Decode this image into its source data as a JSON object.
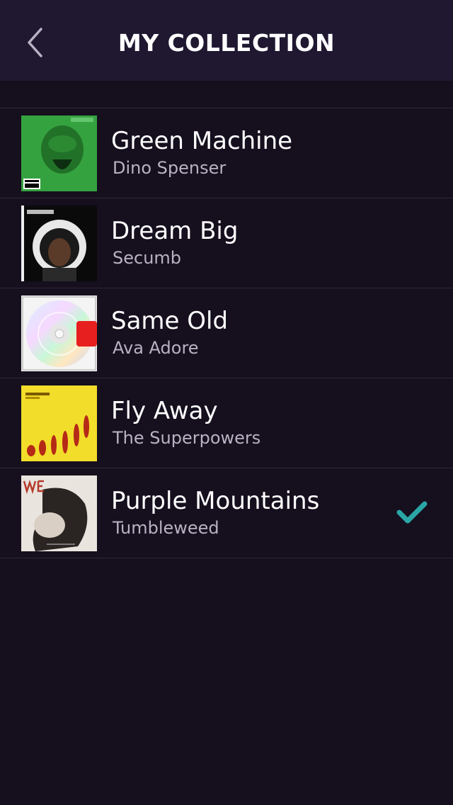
{
  "header": {
    "title": "MY COLLECTION",
    "back_icon": "chevron-left-icon"
  },
  "songs": [
    {
      "title": "Green Machine",
      "artist": "Dino Spenser",
      "selected": false
    },
    {
      "title": "Dream Big",
      "artist": "Secumb",
      "selected": false
    },
    {
      "title": "Same Old",
      "artist": "Ava Adore",
      "selected": false
    },
    {
      "title": "Fly Away",
      "artist": "The Superpowers",
      "selected": false
    },
    {
      "title": "Purple Mountains",
      "artist": "Tumbleweed",
      "selected": true
    }
  ],
  "colors": {
    "background": "#150f1e",
    "header_background": "#1f1830",
    "divider": "#2e2638",
    "subtitle": "#b9b2c4",
    "check_accent": "#2aa6a6"
  },
  "icons": {
    "selected": "checkmark-icon"
  }
}
